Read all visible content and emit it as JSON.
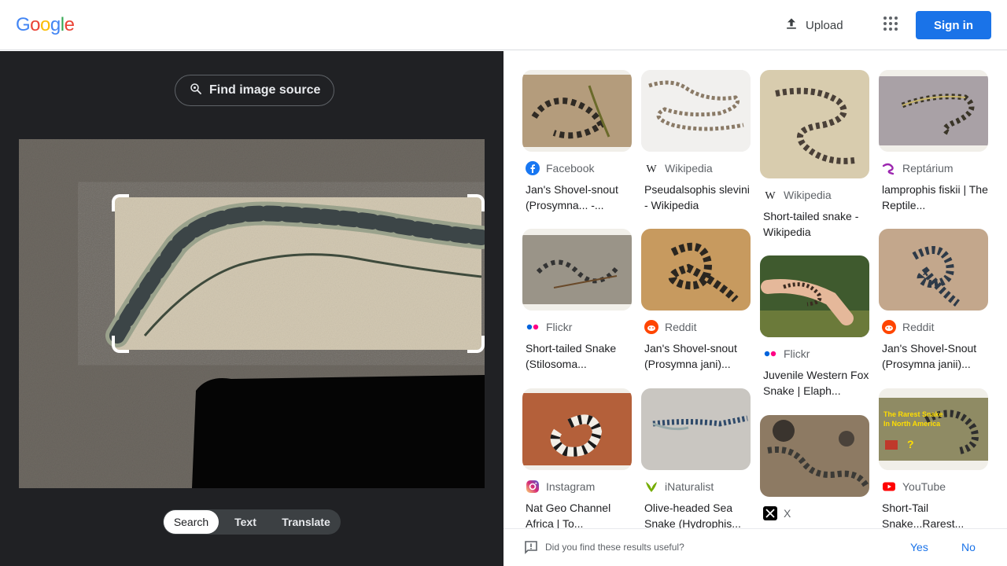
{
  "header": {
    "logo_letters": [
      {
        "ch": "G",
        "color": "#4285F4"
      },
      {
        "ch": "o",
        "color": "#EA4335"
      },
      {
        "ch": "o",
        "color": "#FBBC05"
      },
      {
        "ch": "g",
        "color": "#4285F4"
      },
      {
        "ch": "l",
        "color": "#34A853"
      },
      {
        "ch": "e",
        "color": "#EA4335"
      }
    ],
    "upload_label": "Upload",
    "upload_icon": "upload-icon",
    "apps_icon": "apps-grid-icon",
    "signin_label": "Sign in",
    "accent_color": "#1a73e8"
  },
  "lens": {
    "find_source_label": "Find image source",
    "modes": [
      {
        "label": "Search",
        "active": true
      },
      {
        "label": "Text",
        "active": false
      },
      {
        "label": "Translate",
        "active": false
      }
    ]
  },
  "results": [
    {
      "source": "Facebook",
      "source_icon": "facebook-icon",
      "title": "Jan's Shovel-snout (Prosymna... -..."
    },
    {
      "source": "Wikipedia",
      "source_icon": "wikipedia-icon",
      "title": "Pseudalsophis slevini - Wikipedia"
    },
    {
      "source": "Wikipedia",
      "source_icon": "wikipedia-icon",
      "title": "Short-tailed snake - Wikipedia"
    },
    {
      "source": "Reptárium",
      "source_icon": "reptarium-icon",
      "title": "lamprophis fiskii | The Reptile..."
    },
    {
      "source": "Flickr",
      "source_icon": "flickr-icon",
      "title": "Short-tailed Snake (Stilosoma..."
    },
    {
      "source": "Reddit",
      "source_icon": "reddit-icon",
      "title": "Jan's Shovel-snout (Prosymna jani)..."
    },
    {
      "source": "Flickr",
      "source_icon": "flickr-icon",
      "title": "Juvenile Western Fox Snake | Elaph..."
    },
    {
      "source": "Reddit",
      "source_icon": "reddit-icon",
      "title": "Jan's Shovel-Snout (Prosymna janii)..."
    },
    {
      "source": "Instagram",
      "source_icon": "instagram-icon",
      "title": "Nat Geo Channel Africa | To..."
    },
    {
      "source": "iNaturalist",
      "source_icon": "inaturalist-icon",
      "title": "Olive-headed Sea Snake (Hydrophis..."
    },
    {
      "source": "X",
      "source_icon": "x-icon",
      "title": ""
    },
    {
      "source": "YouTube",
      "source_icon": "youtube-icon",
      "title": "Short-Tail Snake...Rarest..."
    }
  ],
  "thumb_texts": {
    "youtube_overlay_1": "The Rarest Snake",
    "youtube_overlay_2": "In North America"
  },
  "feedback": {
    "question": "Did you find these results useful?",
    "yes": "Yes",
    "no": "No"
  }
}
